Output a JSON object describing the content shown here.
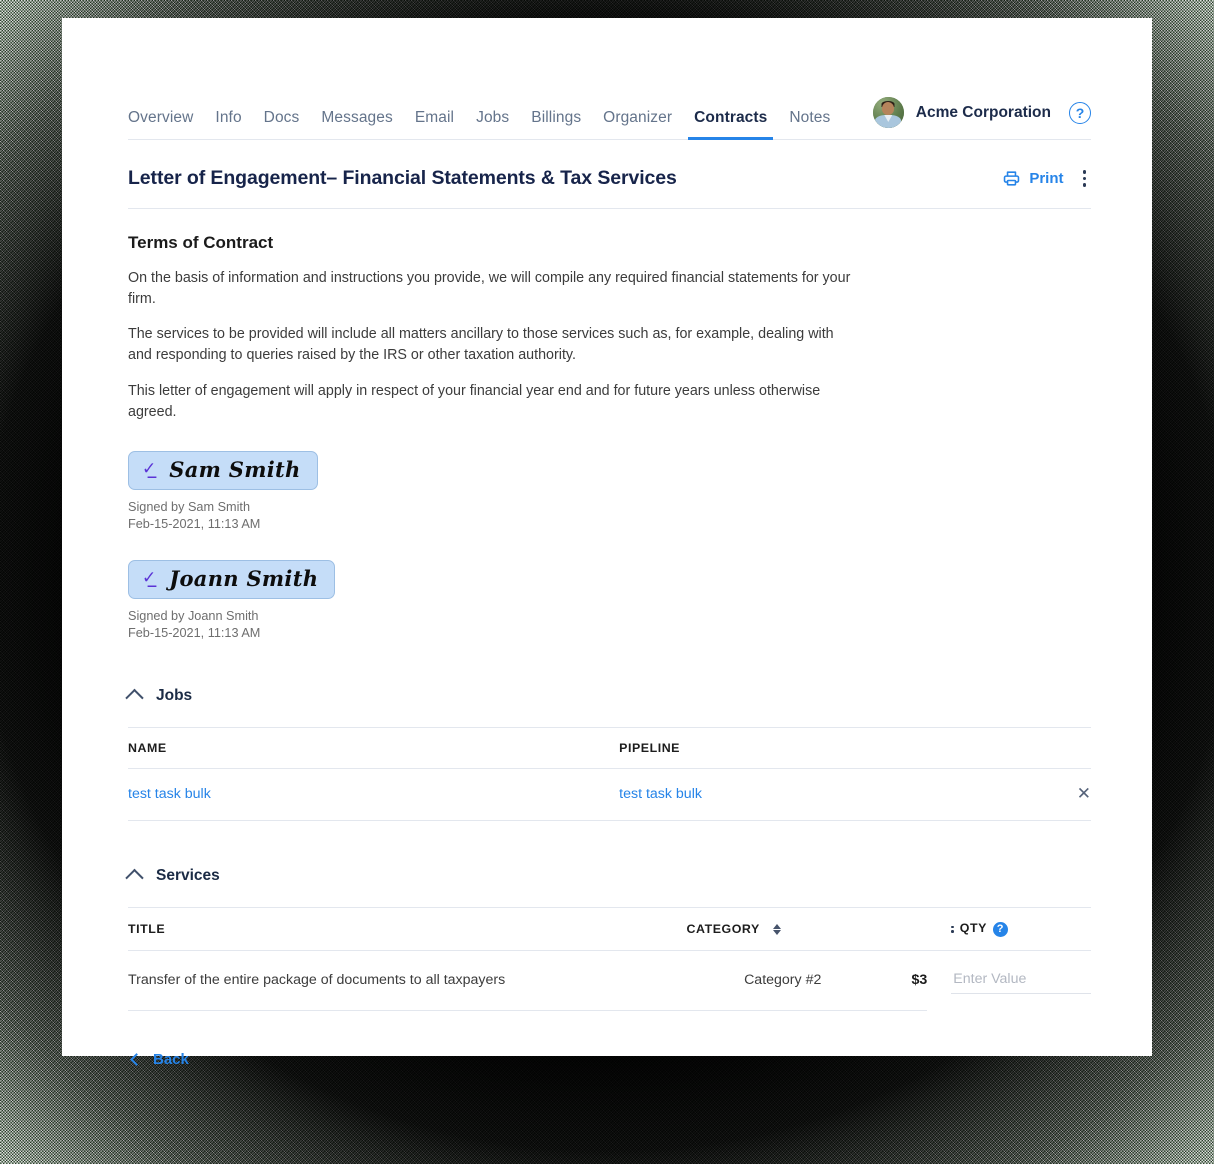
{
  "nav": {
    "tabs": [
      {
        "label": "Overview",
        "active": false
      },
      {
        "label": "Info",
        "active": false
      },
      {
        "label": "Docs",
        "active": false
      },
      {
        "label": "Messages",
        "active": false
      },
      {
        "label": "Email",
        "active": false
      },
      {
        "label": "Jobs",
        "active": false
      },
      {
        "label": "Billings",
        "active": false
      },
      {
        "label": "Organizer",
        "active": false
      },
      {
        "label": "Contracts",
        "active": true
      },
      {
        "label": "Notes",
        "active": false
      }
    ],
    "company": "Acme Corporation",
    "help_icon": "question-circle-icon",
    "avatar_icon": "user-avatar"
  },
  "document": {
    "title": "Letter of Engagement– Financial Statements & Tax Services",
    "print_label": "Print",
    "print_icon": "printer-icon",
    "more_icon": "kebab-menu-icon"
  },
  "terms": {
    "heading": "Terms of Contract",
    "paragraphs": [
      "On the basis of information and instructions you provide, we will compile any required financial statements for your firm.",
      "The services to be provided will include all matters ancillary to those services such as, for example, dealing with and responding to queries raised by the IRS or other taxation authority.",
      "This letter of engagement will apply in respect of your financial year end and for future years unless otherwise agreed."
    ]
  },
  "signatures": [
    {
      "name": "Sam Smith",
      "signed_by": "Signed by Sam Smith",
      "timestamp": "Feb-15-2021, 11:13 AM",
      "pen_icon": "signature-pen-icon"
    },
    {
      "name": "Joann Smith",
      "signed_by": "Signed by Joann Smith",
      "timestamp": "Feb-15-2021, 11:13 AM",
      "pen_icon": "signature-pen-icon"
    }
  ],
  "jobs_section": {
    "title": "Jobs",
    "collapse_icon": "chevron-up-icon",
    "columns": [
      "NAME",
      "PIPELINE"
    ],
    "rows": [
      {
        "name": "test task bulk",
        "pipeline": "test task bulk",
        "remove_icon": "close-x-icon"
      }
    ]
  },
  "services_section": {
    "title": "Services",
    "collapse_icon": "chevron-up-icon",
    "columns": {
      "title": "TITLE",
      "category": "CATEGORY",
      "qty": "QTY"
    },
    "category_sort_icon": "sort-updown-icon",
    "qty_grip_icon": "drag-handle-icon",
    "qty_help_icon": "question-circle-icon",
    "rows": [
      {
        "title": "Transfer of the entire package of documents to all taxpayers",
        "category": "Category #2",
        "price": "$3",
        "qty_value": "",
        "qty_placeholder": "Enter Value"
      }
    ]
  },
  "footer": {
    "back_label": "Back",
    "back_icon": "chevron-left-icon"
  },
  "colors": {
    "accent_blue": "#2684e8",
    "title_navy": "#17244a",
    "signature_bg": "#c5ddf8",
    "signature_pen": "#5b33d6",
    "border": "#e3e7ee"
  }
}
